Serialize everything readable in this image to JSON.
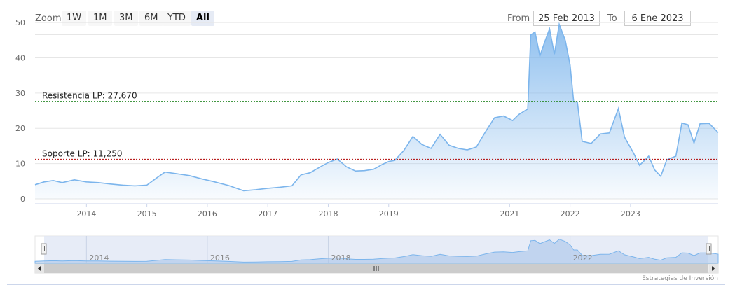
{
  "toolbar": {
    "zoom_label": "Zoom",
    "buttons": [
      "1W",
      "1M",
      "3M",
      "6M",
      "YTD",
      "All"
    ],
    "active": "All",
    "from_label": "From",
    "from_value": "25 Feb 2013",
    "to_label": "To",
    "to_value": "6 Ene 2023"
  },
  "credit": "Estrategias de Inversión",
  "colors": {
    "line": "#7cb5ec",
    "support": "#b00000",
    "resistance": "#2a8a2a",
    "navigator_fill": "#cdd8ee"
  },
  "chart_data": {
    "type": "area",
    "x_start": "2013-02-25",
    "x_end": "2023-01-06",
    "x_ticks": [
      "2014",
      "2015",
      "2016",
      "2017",
      "2018",
      "2019",
      "2021",
      "2022",
      "2023"
    ],
    "y_ticks": [
      "0",
      "10",
      "20",
      "30",
      "40",
      "50"
    ],
    "ylim": [
      0,
      52
    ],
    "series": [
      {
        "values": [
          [
            2013.15,
            4.0
          ],
          [
            2013.3,
            4.8
          ],
          [
            2013.45,
            5.2
          ],
          [
            2013.6,
            4.6
          ],
          [
            2013.8,
            5.4
          ],
          [
            2014.0,
            4.8
          ],
          [
            2014.2,
            4.6
          ],
          [
            2014.4,
            4.2
          ],
          [
            2014.6,
            3.9
          ],
          [
            2014.8,
            3.7
          ],
          [
            2015.0,
            3.9
          ],
          [
            2015.15,
            5.8
          ],
          [
            2015.3,
            7.6
          ],
          [
            2015.5,
            7.1
          ],
          [
            2015.7,
            6.6
          ],
          [
            2015.9,
            5.7
          ],
          [
            2016.1,
            4.9
          ],
          [
            2016.35,
            3.8
          ],
          [
            2016.6,
            2.3
          ],
          [
            2016.8,
            2.6
          ],
          [
            2017.0,
            3.0
          ],
          [
            2017.2,
            3.3
          ],
          [
            2017.4,
            3.7
          ],
          [
            2017.55,
            6.8
          ],
          [
            2017.7,
            7.4
          ],
          [
            2017.85,
            8.9
          ],
          [
            2018.0,
            10.3
          ],
          [
            2018.15,
            11.3
          ],
          [
            2018.3,
            9.1
          ],
          [
            2018.45,
            7.9
          ],
          [
            2018.6,
            8.0
          ],
          [
            2018.75,
            8.4
          ],
          [
            2018.9,
            9.8
          ],
          [
            2019.0,
            10.6
          ],
          [
            2019.1,
            10.9
          ],
          [
            2019.25,
            13.7
          ],
          [
            2019.4,
            17.7
          ],
          [
            2019.55,
            15.4
          ],
          [
            2019.7,
            14.3
          ],
          [
            2019.85,
            18.3
          ],
          [
            2020.0,
            15.2
          ],
          [
            2020.15,
            14.3
          ],
          [
            2020.3,
            13.9
          ],
          [
            2020.45,
            14.7
          ],
          [
            2020.6,
            19.0
          ],
          [
            2020.75,
            23.0
          ],
          [
            2020.9,
            23.5
          ],
          [
            2021.05,
            22.2
          ],
          [
            2021.15,
            23.9
          ],
          [
            2021.3,
            25.5
          ],
          [
            2021.35,
            46.5
          ],
          [
            2021.42,
            47.3
          ],
          [
            2021.5,
            40.5
          ],
          [
            2021.58,
            44.5
          ],
          [
            2021.66,
            48.2
          ],
          [
            2021.74,
            41.0
          ],
          [
            2021.82,
            49.5
          ],
          [
            2021.92,
            45.0
          ],
          [
            2022.0,
            38.0
          ],
          [
            2022.06,
            27.5
          ],
          [
            2022.12,
            27.5
          ],
          [
            2022.2,
            16.3
          ],
          [
            2022.35,
            15.7
          ],
          [
            2022.5,
            18.4
          ],
          [
            2022.65,
            18.7
          ],
          [
            2022.8,
            25.6
          ],
          [
            2022.9,
            17.5
          ],
          [
            2023.05,
            13.0
          ],
          [
            2023.15,
            9.5
          ],
          [
            2023.3,
            12.1
          ],
          [
            2023.4,
            8.2
          ],
          [
            2023.5,
            6.4
          ],
          [
            2023.6,
            11.1
          ],
          [
            2023.75,
            12.1
          ],
          [
            2023.85,
            21.5
          ],
          [
            2023.95,
            21.0
          ],
          [
            2024.05,
            15.8
          ],
          [
            2024.15,
            21.3
          ],
          [
            2024.3,
            21.4
          ],
          [
            2024.45,
            18.8
          ]
        ]
      }
    ],
    "tick_positions": [
      2014.0,
      2015.0,
      2016.0,
      2017.0,
      2018.0,
      2019.0,
      2021.0,
      2022.0,
      2023.0
    ],
    "x_range": [
      2013.15,
      2024.45
    ],
    "support": {
      "label": "Soporte LP: 11,250",
      "value": 11.25
    },
    "resistance": {
      "label": "Resistencia LP: 27,670",
      "value": 27.67
    },
    "grid": true
  },
  "navigator": {
    "labels": [
      "2014",
      "2016",
      "2018",
      "2022"
    ],
    "label_positions": [
      2014.0,
      2016.0,
      2018.0,
      2022.0
    ]
  }
}
